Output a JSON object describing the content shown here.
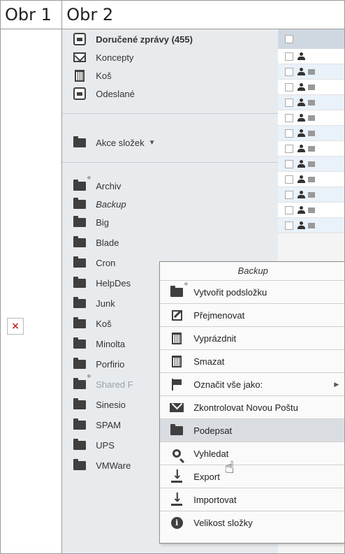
{
  "table": {
    "headers": [
      "Obr 1",
      "Obr 2"
    ]
  },
  "folders": {
    "system": [
      {
        "label": "Doručené zprávy (455)",
        "icon": "inbox-icon"
      },
      {
        "label": "Koncepty",
        "icon": "drafts-icon"
      },
      {
        "label": "Koš",
        "icon": "trash-icon"
      },
      {
        "label": "Odeslané",
        "icon": "sent-icon"
      }
    ],
    "actions_label": "Akce složek",
    "user": [
      {
        "label": "Archiv",
        "icon": "folder-plus-icon"
      },
      {
        "label": "Backup",
        "icon": "folder-icon"
      },
      {
        "label": "Big",
        "icon": "folder-icon"
      },
      {
        "label": "Blade",
        "icon": "folder-icon"
      },
      {
        "label": "Cron",
        "icon": "folder-icon"
      },
      {
        "label": "HelpDes",
        "icon": "folder-icon"
      },
      {
        "label": "Junk",
        "icon": "folder-icon"
      },
      {
        "label": "Koš",
        "icon": "folder-icon"
      },
      {
        "label": "Minolta",
        "icon": "folder-icon"
      },
      {
        "label": "Porfirio",
        "icon": "folder-icon"
      },
      {
        "label": "Shared F",
        "icon": "folder-plus-icon"
      },
      {
        "label": "Sinesio",
        "icon": "folder-icon"
      },
      {
        "label": "SPAM",
        "icon": "folder-icon"
      },
      {
        "label": "UPS",
        "icon": "folder-icon"
      },
      {
        "label": "VMWare",
        "icon": "folder-icon"
      }
    ]
  },
  "context_menu": {
    "title": "Backup",
    "items": [
      {
        "label": "Vytvořit podsložku",
        "icon": "new-subfolder-icon"
      },
      {
        "label": "Přejmenovat",
        "icon": "rename-icon"
      },
      {
        "label": "Vyprázdnit",
        "icon": "empty-icon"
      },
      {
        "label": "Smazat",
        "icon": "delete-icon"
      },
      {
        "label": "Označit vše jako:",
        "icon": "flag-icon"
      },
      {
        "label": "Zkontrolovat Novou Poštu",
        "icon": "mail-check-icon"
      },
      {
        "label": "Podepsat",
        "icon": "sign-icon"
      },
      {
        "label": "Vyhledat",
        "icon": "search-icon"
      },
      {
        "label": "Export",
        "icon": "export-icon"
      },
      {
        "label": "Importovat",
        "icon": "import-icon"
      },
      {
        "label": "Velikost složky",
        "icon": "info-icon"
      }
    ]
  },
  "colors": {
    "folder_panel": "#e8ebee",
    "menu_hover": "#d9dde2",
    "broken_image_x": "#d12b2b"
  }
}
